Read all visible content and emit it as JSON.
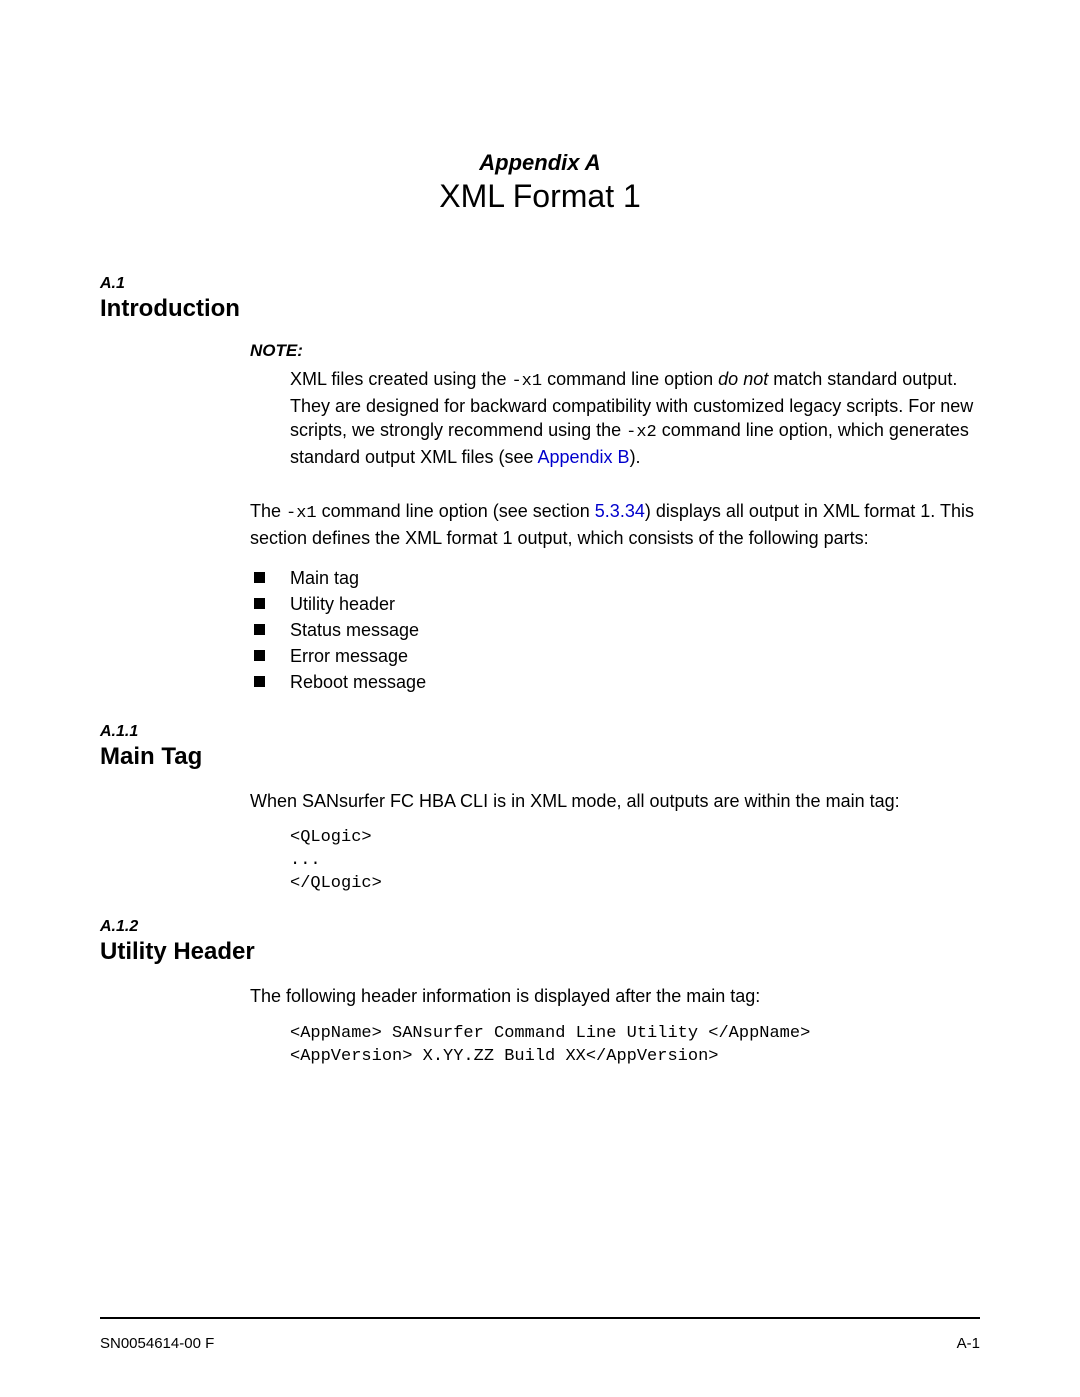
{
  "title": {
    "appendix": "Appendix A",
    "main": "XML Format 1"
  },
  "sections": {
    "intro": {
      "num": "A.1",
      "heading": "Introduction",
      "note_label": "NOTE:",
      "note": {
        "p1a": "XML files created using the ",
        "code1": "-x1",
        "p1b": " command line option ",
        "em1": "do not",
        "p1c": " match standard output. They are designed for backward compatibility with customized legacy scripts. For new scripts, we strongly recommend using the ",
        "code2": "-x2",
        "p1d": " command line option, which generates standard output XML files (see ",
        "link1": "Appendix B",
        "p1e": ")."
      },
      "body": {
        "p1a": "The ",
        "code1": "-x1",
        "p1b": " command line option (see section ",
        "link1": "5.3.34",
        "p1c": ") displays all output in XML format 1. This section defines the XML format 1 output, which consists of the following parts:"
      },
      "bullets": [
        "Main tag",
        "Utility header",
        "Status message",
        "Error message",
        "Reboot message"
      ]
    },
    "maintag": {
      "num": "A.1.1",
      "heading": "Main Tag",
      "para": "When SANsurfer FC HBA CLI is in XML mode, all outputs are within the main tag:",
      "code": "<QLogic>\n...\n</QLogic>"
    },
    "utilheader": {
      "num": "A.1.2",
      "heading": "Utility Header",
      "para": "The following header information is displayed after the main tag:",
      "code": "<AppName> SANsurfer Command Line Utility </AppName>\n<AppVersion> X.YY.ZZ Build XX</AppVersion>"
    }
  },
  "footer": {
    "left": "SN0054614-00 F",
    "right": "A-1"
  }
}
